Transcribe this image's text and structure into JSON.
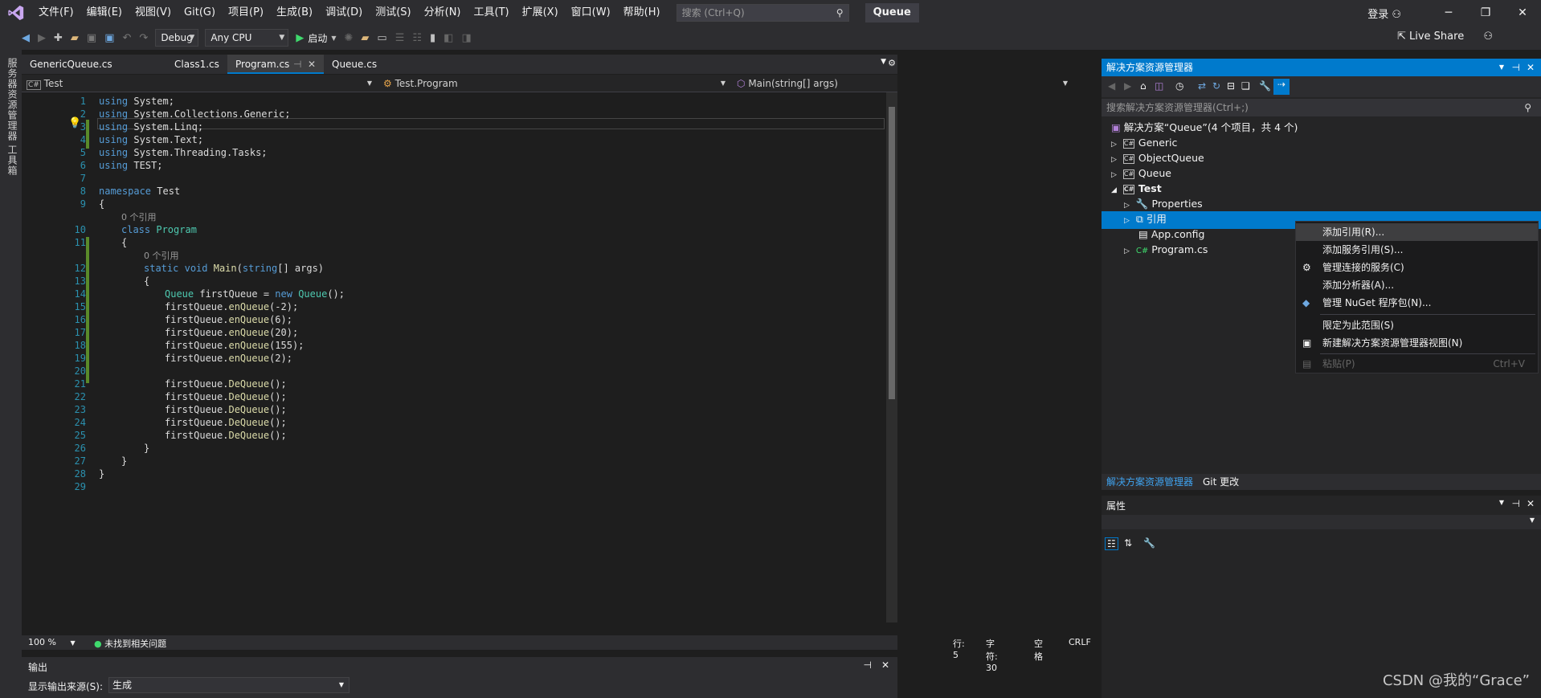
{
  "menubar": {
    "items": [
      "文件(F)",
      "编辑(E)",
      "视图(V)",
      "Git(G)",
      "项目(P)",
      "生成(B)",
      "调试(D)",
      "测试(S)",
      "分析(N)",
      "工具(T)",
      "扩展(X)",
      "窗口(W)",
      "帮助(H)"
    ],
    "search_placeholder": "搜索 (Ctrl+Q)",
    "solution_name": "Queue",
    "login": "登录"
  },
  "toolbar": {
    "config": "Debug",
    "platform": "Any CPU",
    "start": "启动",
    "live_share": "Live Share"
  },
  "sidestrip": {
    "server_explorer": "服务器资源管理器",
    "toolbox": "工具箱"
  },
  "tabs": [
    "GenericQueue.cs",
    "Class1.cs",
    "Program.cs",
    "Queue.cs"
  ],
  "active_tab": "Program.cs",
  "navbar": {
    "project": "Test",
    "class": "Test.Program",
    "member": "Main(string[] args)"
  },
  "code": {
    "line_numbers": [
      "1",
      "2",
      "3",
      "4",
      "5",
      "6",
      "7",
      "8",
      "9",
      "",
      "10",
      "11",
      "",
      "12",
      "13",
      "14",
      "15",
      "16",
      "17",
      "18",
      "19",
      "20",
      "21",
      "22",
      "23",
      "24",
      "25",
      "26",
      "27",
      "28",
      "29"
    ],
    "ref_text": "0 个引用",
    "using": "using",
    "system": "System;",
    "collections": "System.Collections.Generic;",
    "linq": "System.Linq;",
    "text": "System.Text;",
    "tasks": "System.Threading.Tasks;",
    "test_ns_using": "TEST;",
    "namespace_kw": "namespace",
    "namespace_name": "Test",
    "class_kw": "class",
    "class_name": "Program",
    "static_kw": "static",
    "void_kw": "void",
    "main": "Main",
    "string_kw": "string",
    "args": "[] args)",
    "queue_type": "Queue",
    "var_decl": "firstQueue = ",
    "new_kw": "new",
    "ctor_end": "();",
    "enqueue_calls": [
      "(-2);",
      "(6);",
      "(20);",
      "(155);",
      "(2);"
    ],
    "var_name": "firstQueue.",
    "enqueue_fn": "enQueue",
    "dequeue_fn": "DeQueue",
    "dequeue_end": "();",
    "open_brace": "{",
    "close_brace": "}"
  },
  "editor_status": {
    "zoom": "100 %",
    "issues": "未找到相关问题",
    "line": "行: 5",
    "char": "字符: 30",
    "space": "空格",
    "eol": "CRLF"
  },
  "output": {
    "title": "输出",
    "source_label": "显示输出来源(S):",
    "source_value": "生成"
  },
  "solution_explorer": {
    "title": "解决方案资源管理器",
    "search_placeholder": "搜索解决方案资源管理器(Ctrl+;)",
    "solution": "解决方案“Queue”(4 个项目，共 4 个)",
    "projects": [
      "Generic",
      "ObjectQueue",
      "Queue",
      "Test"
    ],
    "test_children": [
      "Properties",
      "引用",
      "App.config",
      "Program.cs"
    ],
    "bottom_tabs": [
      "解决方案资源管理器",
      "Git 更改"
    ]
  },
  "properties": {
    "title": "属性"
  },
  "context_menu": {
    "items": [
      {
        "label": "添加引用(R)...",
        "shortcut": ""
      },
      {
        "label": "添加服务引用(S)...",
        "shortcut": ""
      },
      {
        "label": "管理连接的服务(C)",
        "shortcut": ""
      },
      {
        "label": "添加分析器(A)...",
        "shortcut": ""
      },
      {
        "label": "管理 NuGet 程序包(N)...",
        "shortcut": ""
      },
      {
        "label": "限定为此范围(S)",
        "shortcut": ""
      },
      {
        "label": "新建解决方案资源管理器视图(N)",
        "shortcut": ""
      },
      {
        "label": "粘贴(P)",
        "shortcut": "Ctrl+V"
      }
    ]
  },
  "watermark": "CSDN @我的“Grace”",
  "colors": {
    "accent": "#007acc",
    "background": "#1e1e1e",
    "chrome": "#2d2d30",
    "keyword": "#569cd6",
    "type": "#4ec9b0",
    "method": "#dcdcaa",
    "line_number": "#2b91af"
  }
}
